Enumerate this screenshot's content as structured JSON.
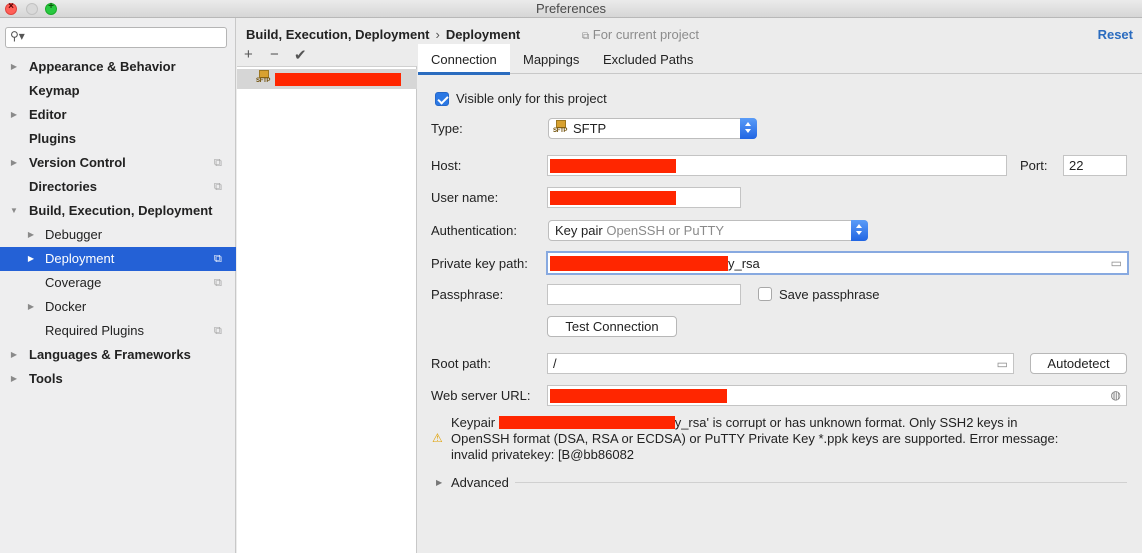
{
  "window": {
    "title": "Preferences"
  },
  "sidebar": {
    "search_placeholder": "",
    "items": [
      {
        "label": "Appearance & Behavior",
        "level": "top",
        "arrow": "▶",
        "project": false
      },
      {
        "label": "Keymap",
        "level": "top",
        "arrow": "",
        "project": false
      },
      {
        "label": "Editor",
        "level": "top",
        "arrow": "▶",
        "project": false
      },
      {
        "label": "Plugins",
        "level": "top",
        "arrow": "",
        "project": false
      },
      {
        "label": "Version Control",
        "level": "top",
        "arrow": "▶",
        "project": true
      },
      {
        "label": "Directories",
        "level": "top",
        "arrow": "",
        "project": true
      },
      {
        "label": "Build, Execution, Deployment",
        "level": "top",
        "arrow": "▼",
        "project": false
      },
      {
        "label": "Debugger",
        "level": "sub",
        "arrow": "▶",
        "project": false
      },
      {
        "label": "Deployment",
        "level": "sub",
        "arrow": "▶",
        "project": true,
        "selected": true
      },
      {
        "label": "Coverage",
        "level": "sub",
        "arrow": "",
        "project": true
      },
      {
        "label": "Docker",
        "level": "sub",
        "arrow": "▶",
        "project": false
      },
      {
        "label": "Required Plugins",
        "level": "sub",
        "arrow": "",
        "project": true
      },
      {
        "label": "Languages & Frameworks",
        "level": "top",
        "arrow": "▶",
        "project": false
      },
      {
        "label": "Tools",
        "level": "top",
        "arrow": "▶",
        "project": false
      }
    ]
  },
  "header": {
    "breadcrumb_parent": "Build, Execution, Deployment",
    "breadcrumb_sep": "›",
    "breadcrumb_current": "Deployment",
    "for_project": "For current project",
    "reset": "Reset"
  },
  "server_toolbar": {
    "add": "+",
    "remove": "−",
    "apply": "✔"
  },
  "server_list": {
    "badge": "SFTP"
  },
  "tabs": [
    "Connection",
    "Mappings",
    "Excluded Paths"
  ],
  "form": {
    "visible_only": "Visible only for this project",
    "type_label": "Type:",
    "type_value": "SFTP",
    "host_label": "Host:",
    "port_label": "Port:",
    "port_value": "22",
    "username_label": "User name:",
    "auth_label": "Authentication:",
    "auth_value": "Key pair",
    "auth_hint": "OpenSSH or PuTTY",
    "private_key_label": "Private key path:",
    "private_key_suffix": "y_rsa",
    "passphrase_label": "Passphrase:",
    "save_passphrase": "Save passphrase",
    "test_connection": "Test Connection",
    "root_path_label": "Root path:",
    "root_path_value": "/",
    "autodetect": "Autodetect",
    "web_url_label": "Web server URL:"
  },
  "warning": {
    "line1_prefix": "Keypair",
    "line1_suffix": "y_rsa' is corrupt or has unknown format. Only SSH2 keys in",
    "line2": "OpenSSH format (DSA, RSA or ECDSA) or PuTTY Private Key *.ppk keys are supported. Error message:",
    "line3": "invalid privatekey: [B@bb86082"
  },
  "advanced": "Advanced",
  "colors": {
    "accent": "#2461d6",
    "redaction": "#ff2600",
    "link": "#2b6cbf"
  }
}
